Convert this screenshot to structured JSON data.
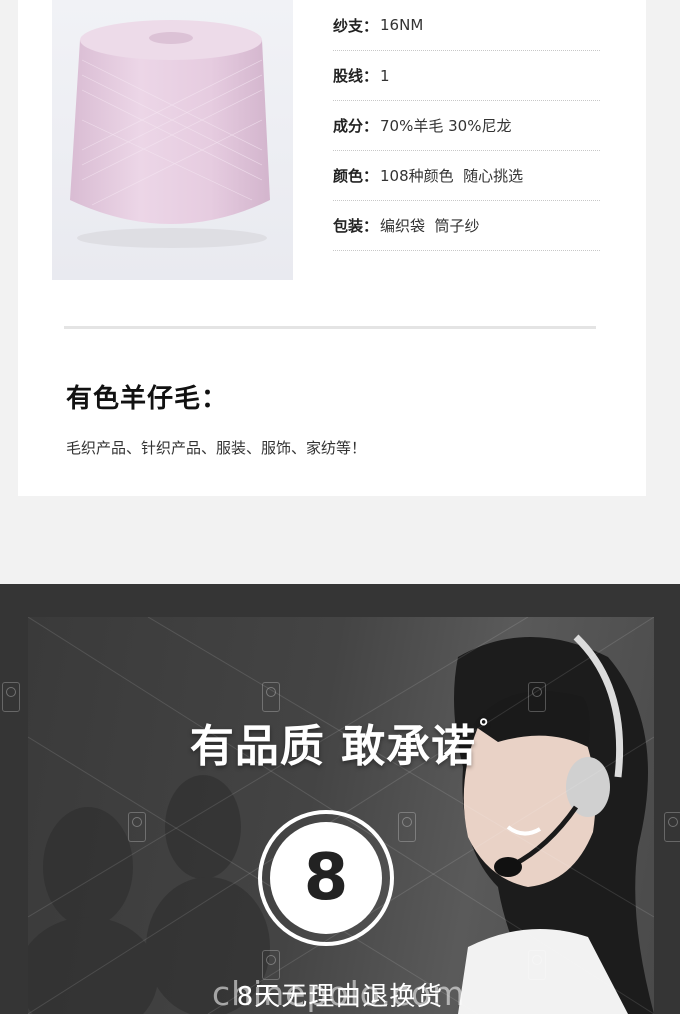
{
  "product": {
    "image_alt": "纱线筒",
    "yarn_color": "#e7cfe2"
  },
  "specs": [
    {
      "key": "纱支：",
      "value": "16NM"
    },
    {
      "key": "股线：",
      "value": "1"
    },
    {
      "key": "成分：",
      "value": "70%羊毛 30%尼龙"
    },
    {
      "key": "颜色：",
      "value": "108种颜色  随心挑选"
    },
    {
      "key": "包装：",
      "value": "编织袋  筒子纱"
    }
  ],
  "section": {
    "title": "有色羊仔毛：",
    "description": "毛织产品、针织产品、服装、服饰、家纺等！"
  },
  "promo": {
    "title": "有品质 敢承诺",
    "title_mark": "°",
    "number": "8",
    "caption": "8天无理由退换货"
  },
  "watermark": {
    "text": "chinepolo.com"
  }
}
